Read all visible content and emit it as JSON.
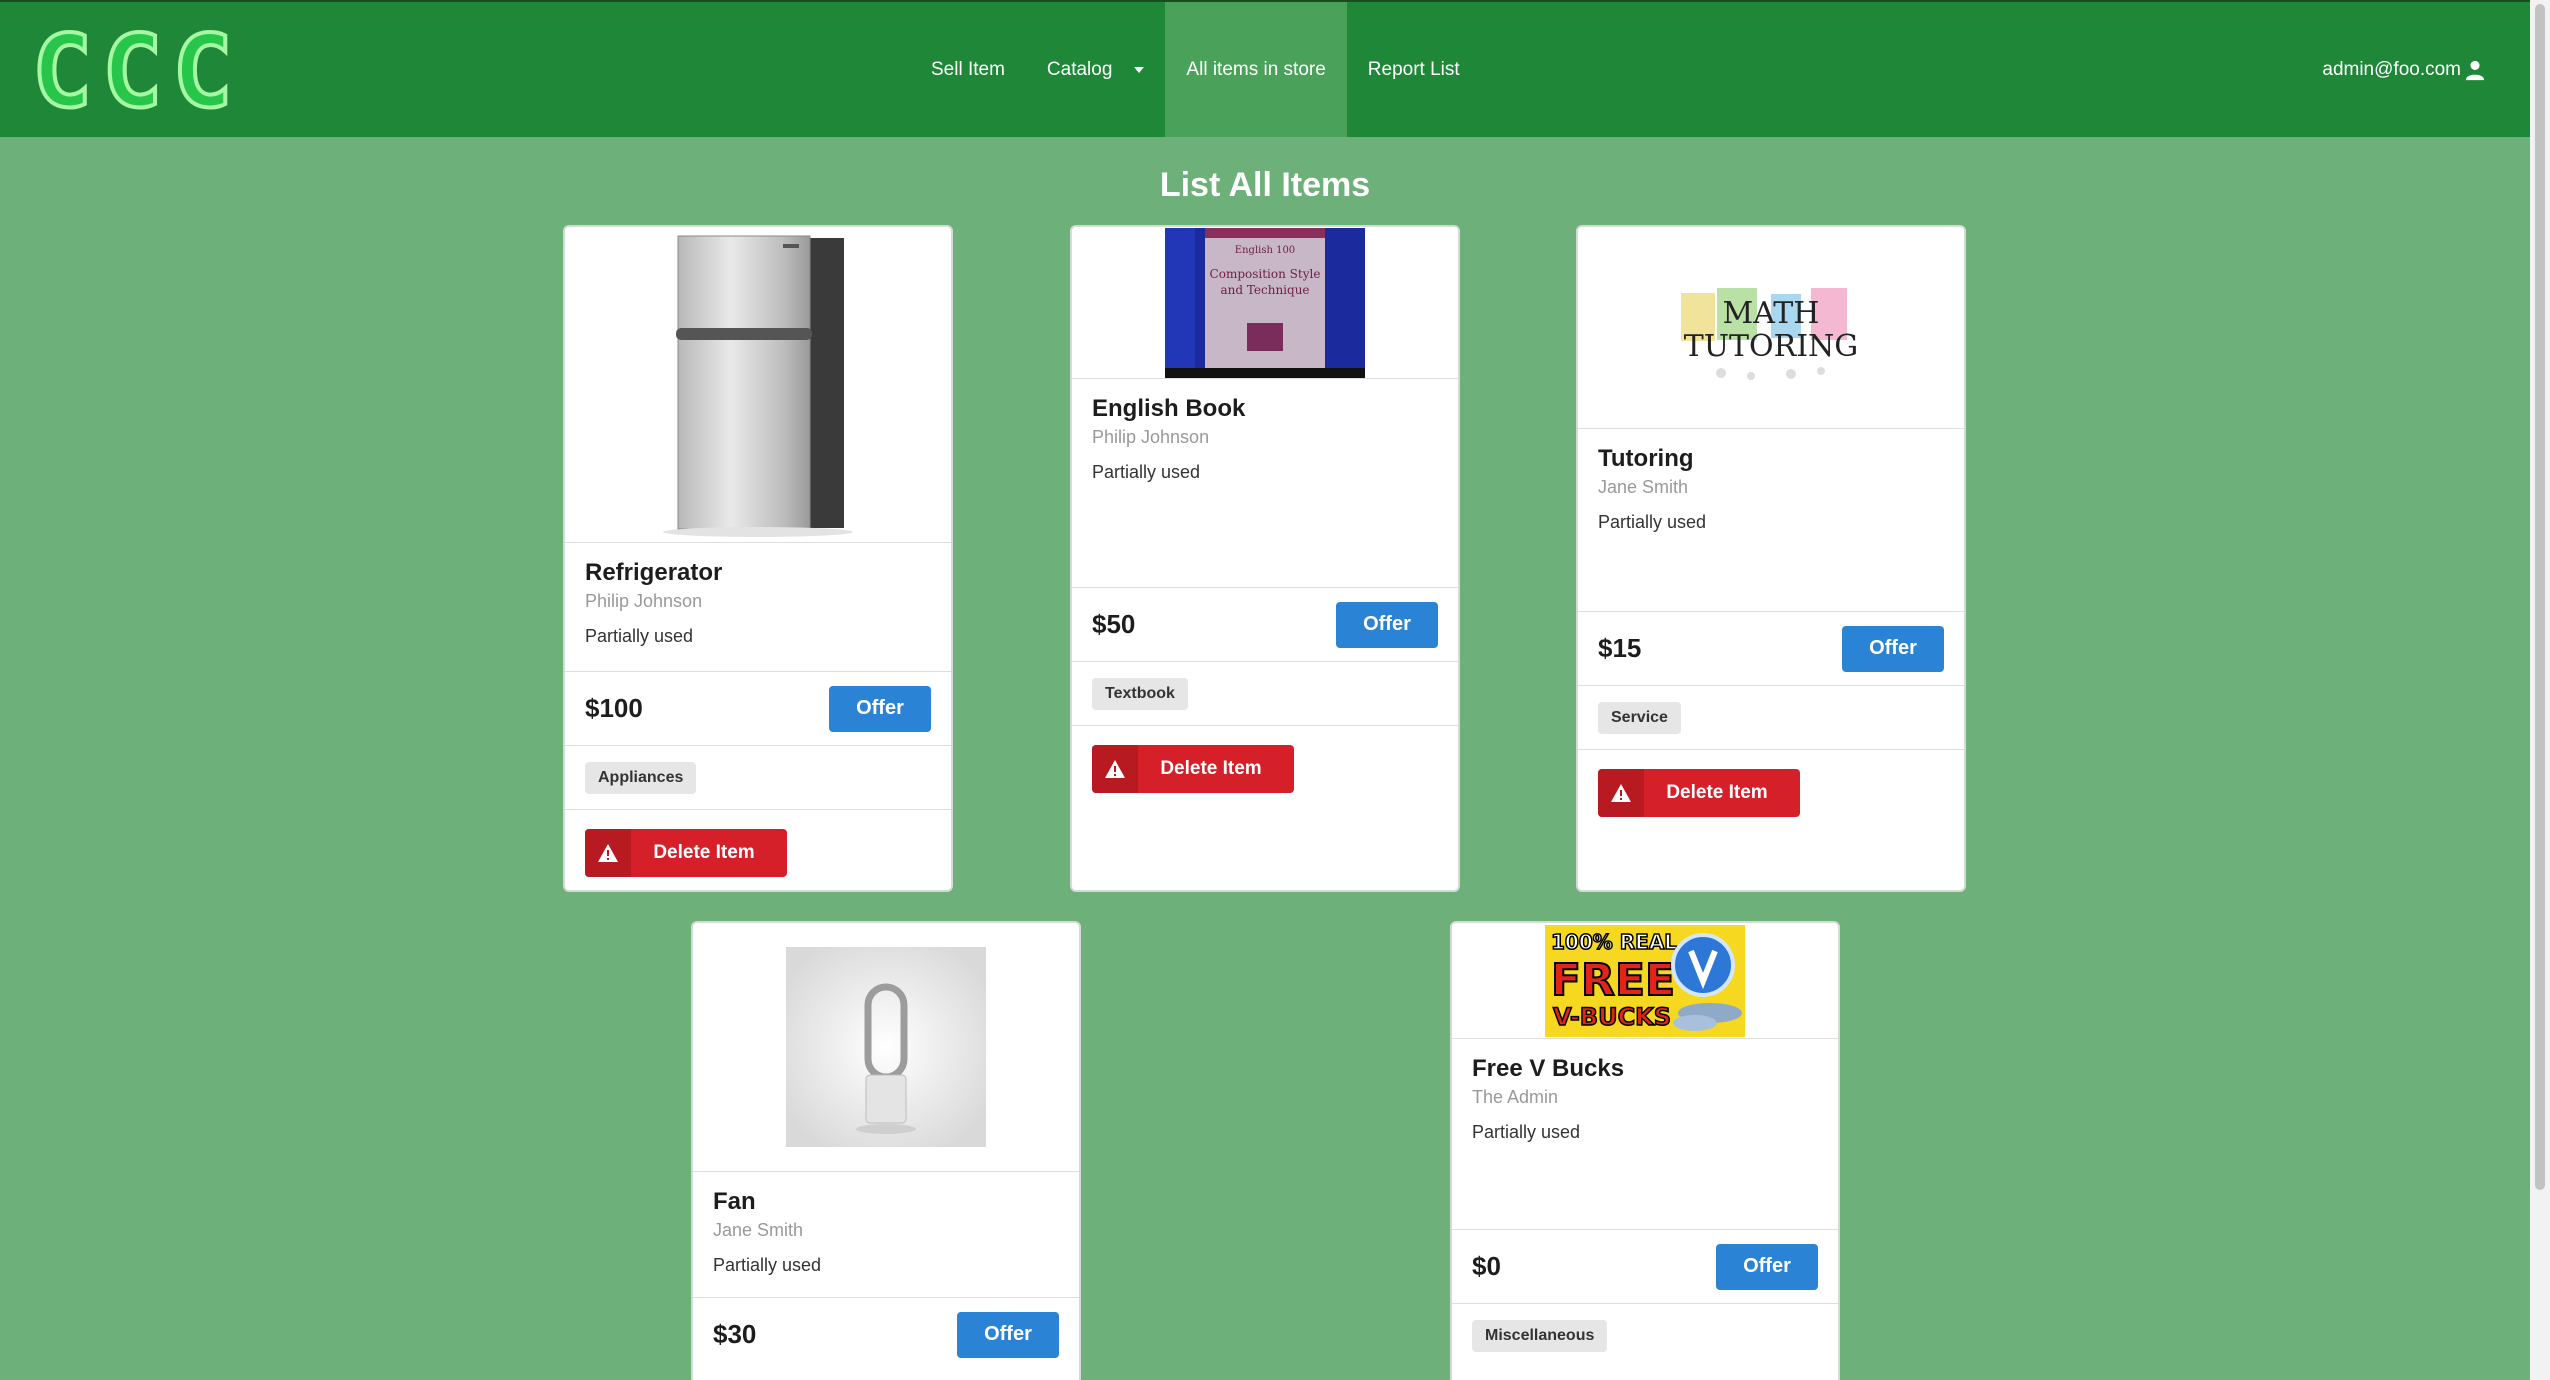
{
  "nav": {
    "logo": "CCC",
    "items": [
      "Sell Item",
      "Catalog",
      "All items in store",
      "Report List"
    ],
    "active_index": 2,
    "user_email": "admin@foo.com"
  },
  "page": {
    "title": "List All Items"
  },
  "colors": {
    "navbar": "#1e8838",
    "active_nav": "#4aa25a",
    "background": "#6db07a",
    "offer": "#2a83d4",
    "delete": "#d5202a"
  },
  "cards": [
    {
      "name": "Refrigerator",
      "seller": "Philip Johnson",
      "condition": "Partially used",
      "price": "$100",
      "offer_label": "Offer",
      "tag": "Appliances",
      "delete_label": "Delete Item"
    },
    {
      "name": "English Book",
      "seller": "Philip Johnson",
      "condition": "Partially used",
      "price": "$50",
      "offer_label": "Offer",
      "tag": "Textbook",
      "delete_label": "Delete Item",
      "image_text": [
        "English 100",
        "Composition Style",
        "and Technique"
      ]
    },
    {
      "name": "Tutoring",
      "seller": "Jane Smith",
      "condition": "Partially used",
      "price": "$15",
      "offer_label": "Offer",
      "tag": "Service",
      "delete_label": "Delete Item",
      "image_text": [
        "MATH",
        "TUTORING"
      ]
    },
    {
      "name": "Fan",
      "seller": "Jane Smith",
      "condition": "Partially used",
      "price": "$30",
      "offer_label": "Offer"
    },
    {
      "name": "Free V Bucks",
      "seller": "The Admin",
      "condition": "Partially used",
      "price": "$0",
      "offer_label": "Offer",
      "tag": "Miscellaneous",
      "image_text": [
        "100% REAL",
        "FREE",
        "V-BUCKS"
      ]
    }
  ]
}
